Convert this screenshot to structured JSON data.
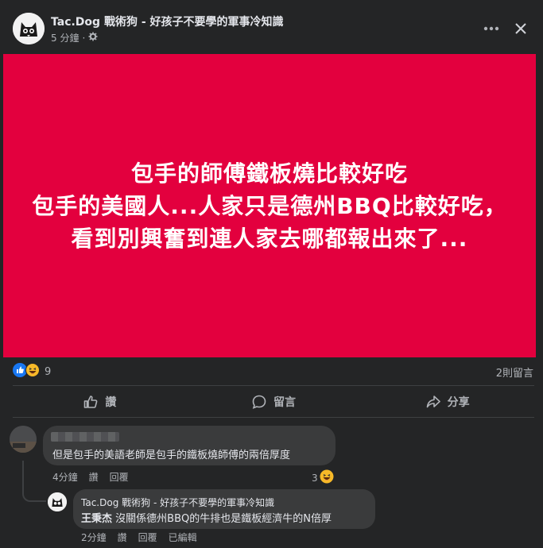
{
  "post": {
    "page_name": "Tac.Dog 戰術狗 - 好孩子不要學的軍事冷知識",
    "time": "5 分鐘",
    "dot": "·",
    "privacy_icon": "gear-icon",
    "more_icon": "more-icon",
    "close_icon": "close-icon"
  },
  "image": {
    "background": "#e3003e",
    "lines": [
      "包手的師傅鐵板燒比較好吃",
      "包手的美國人...人家只是德州BBQ比較好吃，",
      "看到別興奮到連人家去哪都報出來了..."
    ]
  },
  "reactions": {
    "icons": [
      "like-icon",
      "haha-icon"
    ],
    "count": "9",
    "comment_count": "2則留言"
  },
  "actions": {
    "like": "讚",
    "comment": "留言",
    "share": "分享"
  },
  "comments": [
    {
      "text": "但是包手的美語老師是包手的鐵板燒師傅的兩倍厚度",
      "time": "4分鐘",
      "like": "讚",
      "reply": "回覆",
      "reaction_count": "3",
      "reaction_icon": "haha-icon"
    }
  ],
  "reply": {
    "author": "Tac.Dog 戰術狗 - 好孩子不要學的軍事冷知識",
    "mention": "王秉杰",
    "text": " 沒關係德州BBQ的牛排也是鐵板經濟牛的N倍厚",
    "time": "2分鐘",
    "like": "讚",
    "reply": "回覆",
    "edited": "已編輯"
  }
}
